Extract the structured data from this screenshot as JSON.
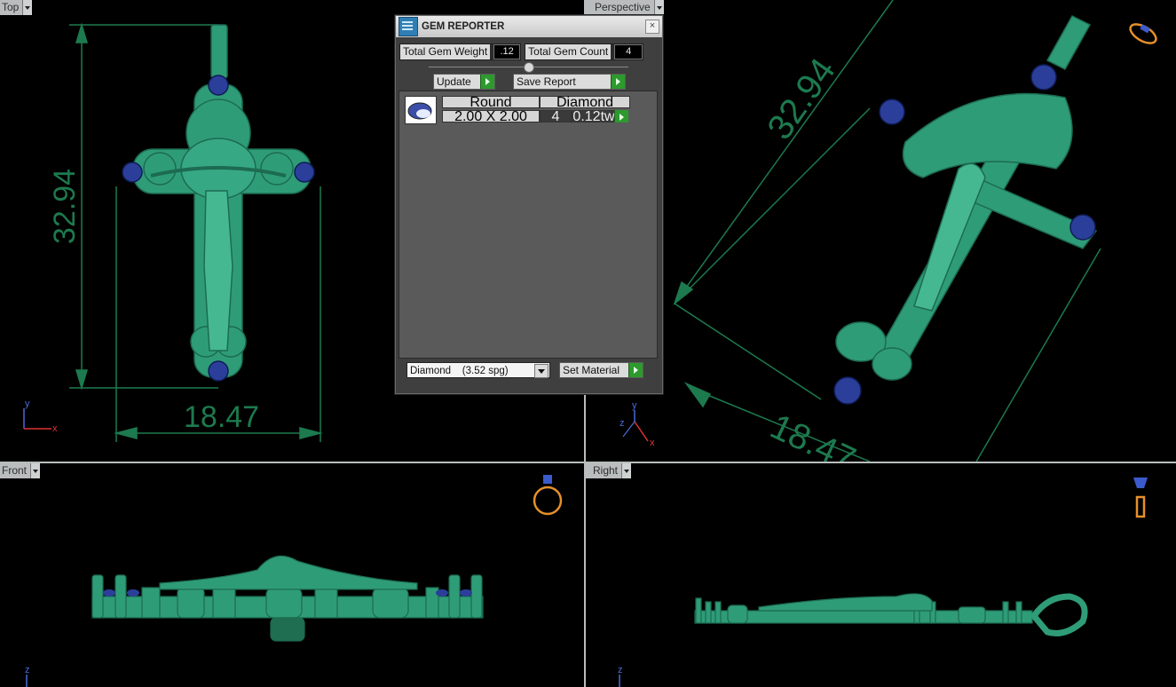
{
  "viewports": {
    "top": {
      "label": "Top",
      "dim_height": "32.94",
      "dim_width": "18.47",
      "axis_y": "y",
      "axis_x": "x"
    },
    "perspective": {
      "label": "Perspective",
      "dim_height": "32.94",
      "dim_width": "18.47",
      "axis_z": "z",
      "axis_y": "y",
      "axis_x": "x"
    },
    "front": {
      "label": "Front",
      "axis_z": "z"
    },
    "right": {
      "label": "Right",
      "axis_z": "z"
    }
  },
  "gem_reporter": {
    "title": "GEM REPORTER",
    "close_glyph": "×",
    "total_weight_label": "Total Gem Weight",
    "total_weight_value": ".12",
    "total_count_label": "Total Gem Count",
    "total_count_value": "4",
    "update_label": "Update",
    "save_report_label": "Save Report",
    "table": {
      "shape": "Round",
      "type": "Diamond",
      "size": "2.00 X 2.00",
      "count": "4",
      "weight": "0.12tw"
    },
    "material_value": "Diamond    (3.52 spg)",
    "set_material_label": "Set Material"
  },
  "colors": {
    "model": "#2f9c78",
    "model_dark": "#1c6b50",
    "gem": "#2b3f9a",
    "dimension": "#1d7a4e",
    "axis_x": "#d33",
    "axis_y": "#4a6bd8"
  }
}
